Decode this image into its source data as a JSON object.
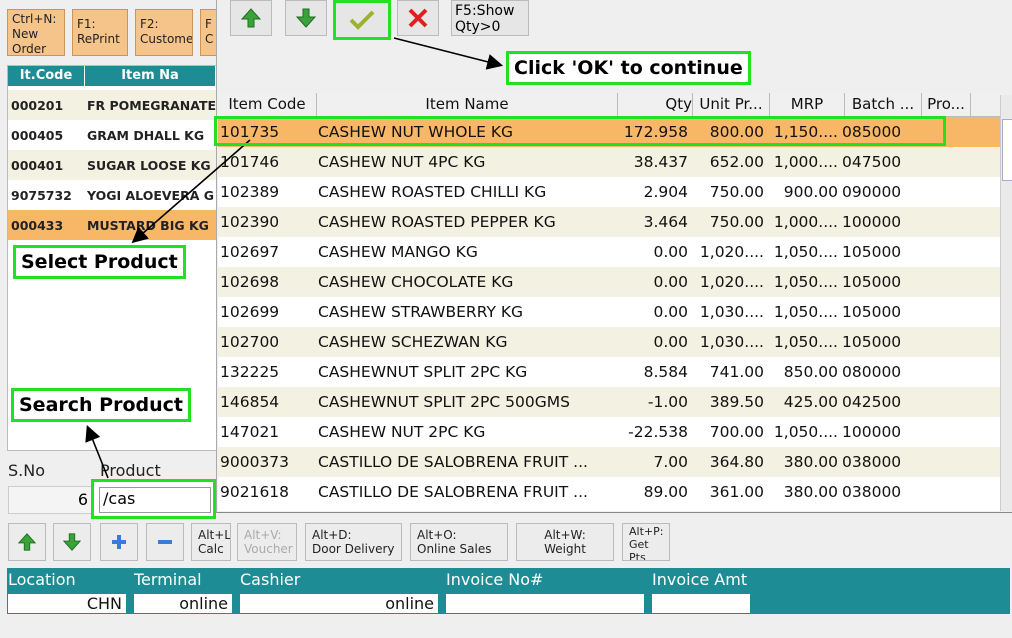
{
  "topbar": {
    "buttons": [
      {
        "label": "Ctrl+N:\nNew\nOrder"
      },
      {
        "label": "F1:\nRePrint"
      },
      {
        "label": "F2:\nCustome"
      },
      {
        "label": "F\nC"
      }
    ]
  },
  "order_list": {
    "headers": [
      "It.Code",
      "Item Na"
    ],
    "rows": [
      {
        "code": "000201",
        "name": "FR POMEGRANATE"
      },
      {
        "code": "000405",
        "name": "GRAM DHALL  KG"
      },
      {
        "code": "000401",
        "name": "SUGAR LOOSE KG"
      },
      {
        "code": "9075732",
        "name": "YOGI ALOEVERA G"
      },
      {
        "code": "000433",
        "name": "MUSTARD BIG KG"
      }
    ]
  },
  "entry": {
    "sno_label": "S.No",
    "product_label": "Product",
    "sno_value": "6",
    "product_value": "/cas"
  },
  "popup": {
    "f5_label": "F5:Show\nQty>0",
    "columns": [
      "Item Code",
      "Item Name",
      "Qty",
      "Unit Pr...",
      "MRP",
      "Batch ...",
      "Pro..."
    ],
    "rows": [
      {
        "code": "101735",
        "name": "CASHEW NUT WHOLE KG",
        "qty": "172.958",
        "unit": "800.00",
        "mrp": "1,150....",
        "batch": "085000"
      },
      {
        "code": "101746",
        "name": "CASHEW NUT 4PC KG",
        "qty": "38.437",
        "unit": "652.00",
        "mrp": "1,000....",
        "batch": "047500"
      },
      {
        "code": "102389",
        "name": "CASHEW ROASTED CHILLI KG",
        "qty": "2.904",
        "unit": "750.00",
        "mrp": "900.00",
        "batch": "090000"
      },
      {
        "code": "102390",
        "name": "CASHEW ROASTED PEPPER KG",
        "qty": "3.464",
        "unit": "750.00",
        "mrp": "1,000....",
        "batch": "100000"
      },
      {
        "code": "102697",
        "name": "CASHEW MANGO KG",
        "qty": "0.00",
        "unit": "1,020....",
        "mrp": "1,050....",
        "batch": "105000"
      },
      {
        "code": "102698",
        "name": "CASHEW CHOCOLATE KG",
        "qty": "0.00",
        "unit": "1,020....",
        "mrp": "1,050....",
        "batch": "105000"
      },
      {
        "code": "102699",
        "name": "CASHEW STRAWBERRY KG",
        "qty": "0.00",
        "unit": "1,030....",
        "mrp": "1,050....",
        "batch": "105000"
      },
      {
        "code": "102700",
        "name": "CASHEW SCHEZWAN KG",
        "qty": "0.00",
        "unit": "1,030....",
        "mrp": "1,050....",
        "batch": "105000"
      },
      {
        "code": "132225",
        "name": "CASHEWNUT SPLIT 2PC KG",
        "qty": "8.584",
        "unit": "741.00",
        "mrp": "850.00",
        "batch": "080000"
      },
      {
        "code": "146854",
        "name": "CASHEWNUT SPLIT 2PC 500GMS",
        "qty": "-1.00",
        "unit": "389.50",
        "mrp": "425.00",
        "batch": "042500"
      },
      {
        "code": "147021",
        "name": "CASHEW NUT 2PC KG",
        "qty": "-22.538",
        "unit": "700.00",
        "mrp": "1,050....",
        "batch": "100000"
      },
      {
        "code": "9000373",
        "name": "CASTILLO DE SALOBRENA FRUIT ...",
        "qty": "7.00",
        "unit": "364.80",
        "mrp": "380.00",
        "batch": "038000"
      },
      {
        "code": "9021618",
        "name": "CASTILLO DE SALOBRENA FRUIT ...",
        "qty": "89.00",
        "unit": "361.00",
        "mrp": "380.00",
        "batch": "038000"
      }
    ]
  },
  "callouts": {
    "ok": "Click 'OK' to continue",
    "select": "Select Product",
    "search": "Search Product"
  },
  "bottom_toolbar": {
    "buttons": [
      {
        "label": "Alt+L:\nCalc"
      },
      {
        "label": "Alt+V:\nVoucher"
      },
      {
        "label": "Alt+D:\nDoor Delivery"
      },
      {
        "label": "Alt+O:\nOnline Sales"
      },
      {
        "label": "Alt+W:\nWeight"
      },
      {
        "label": "Alt+P:\nGet\nPts"
      }
    ]
  },
  "status": {
    "labels": [
      "Location",
      "Terminal",
      "Cashier",
      "Invoice No#",
      "Invoice Amt"
    ],
    "values": [
      "CHN",
      "online",
      "online",
      "",
      ""
    ]
  },
  "colors": {
    "teal": "#1e8c94",
    "highlight": "#f8b767",
    "callout_border": "#22e022"
  }
}
